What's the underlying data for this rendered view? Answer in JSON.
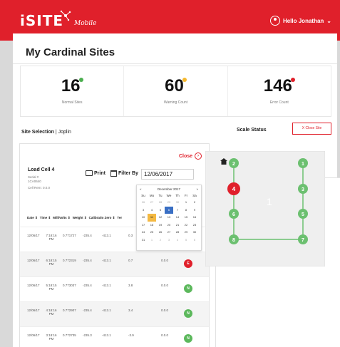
{
  "header": {
    "logo_text": "iSITE",
    "logo_sub": "Mobile",
    "user_greeting": "Hello Jonathan",
    "brand_color": "#e0202b"
  },
  "page": {
    "title": "My Cardinal Sites"
  },
  "stats": [
    {
      "value": "16",
      "label": "Normal Sites",
      "dot_color": "#4caf50"
    },
    {
      "value": "60",
      "label": "Warning Count",
      "dot_color": "#f5b82e"
    },
    {
      "value": "146",
      "label": "Error Count",
      "dot_color": "#e0202b"
    }
  ],
  "site_selection": {
    "label": "Site Selection",
    "site": "Joplin"
  },
  "scale_status": {
    "title": "Scale Status",
    "close_button": "X Close Site"
  },
  "load_cell": {
    "close_label": "Close",
    "title": "Load Cell 4",
    "serial_label": "Serial #",
    "serial_value": "1CA0640",
    "cell_rem": "Cell Rem: 0.0.0",
    "print_label": "Print",
    "filter_label": "Filter By",
    "date_value": "12/06/2017"
  },
  "table": {
    "headers": [
      "Date ⇕",
      "Time ⇕",
      "MilliVolts ⇕",
      "Weight ⇕",
      "Calibratio Zero ⇕",
      "Ter"
    ],
    "rows": [
      {
        "date": "12/06/17",
        "time": "7:18:16 PM",
        "mv": "0.771727",
        "weight": "-235.4",
        "cal": "-413.1",
        "zero": "0.3",
        "ter": "",
        "status": "",
        "status_color": ""
      },
      {
        "date": "12/06/17",
        "time": "6:18:15 PM",
        "mv": "0.772319",
        "weight": "-235.4",
        "cal": "-413.1",
        "zero": "0.7",
        "ter": "0.0.0",
        "status": "E",
        "status_color": "#e0202b"
      },
      {
        "date": "12/06/17",
        "time": "5:18:15 PM",
        "mv": "0.773037",
        "weight": "-235.4",
        "cal": "-413.1",
        "zero": "3.8",
        "ter": "0.0.0",
        "status": "N",
        "status_color": "#5cb85c"
      },
      {
        "date": "12/06/17",
        "time": "4:18:16 PM",
        "mv": "0.772907",
        "weight": "-235.4",
        "cal": "-413.1",
        "zero": "3.4",
        "ter": "0.0.0",
        "status": "N",
        "status_color": "#5cb85c"
      },
      {
        "date": "12/06/17",
        "time": "3:18:16 PM",
        "mv": "0.772735",
        "weight": "-235.3",
        "cal": "-413.1",
        "zero": "-3.9",
        "ter": "0.0.0",
        "status": "N",
        "status_color": "#5cb85c"
      }
    ]
  },
  "calendar": {
    "month_label": "December 2017",
    "prev": "«",
    "next": "»",
    "dow": [
      "Su",
      "Mo",
      "Tu",
      "We",
      "Th",
      "Fr",
      "Sa"
    ],
    "weeks": [
      [
        "26",
        "27",
        "28",
        "29",
        "30",
        "1",
        "2"
      ],
      [
        "3",
        "4",
        "5",
        "6",
        "7",
        "8",
        "9"
      ],
      [
        "10",
        "11",
        "12",
        "13",
        "14",
        "15",
        "16"
      ],
      [
        "17",
        "18",
        "19",
        "20",
        "21",
        "22",
        "23"
      ],
      [
        "24",
        "25",
        "26",
        "27",
        "28",
        "29",
        "30"
      ],
      [
        "31",
        "1",
        "2",
        "3",
        "4",
        "5",
        "6"
      ]
    ],
    "selected_day": "6",
    "today_day": "11"
  },
  "scale_diagram": {
    "center_label": "1",
    "home_icon": "home-icon",
    "nodes": [
      {
        "label": "2",
        "color": "#6cc070"
      },
      {
        "label": "1",
        "color": "#6cc070"
      },
      {
        "label": "4",
        "color": "#e0202b"
      },
      {
        "label": "3",
        "color": "#6cc070"
      },
      {
        "label": "6",
        "color": "#6cc070"
      },
      {
        "label": "5",
        "color": "#6cc070"
      },
      {
        "label": "8",
        "color": "#6cc070"
      },
      {
        "label": "7",
        "color": "#6cc070"
      }
    ]
  }
}
